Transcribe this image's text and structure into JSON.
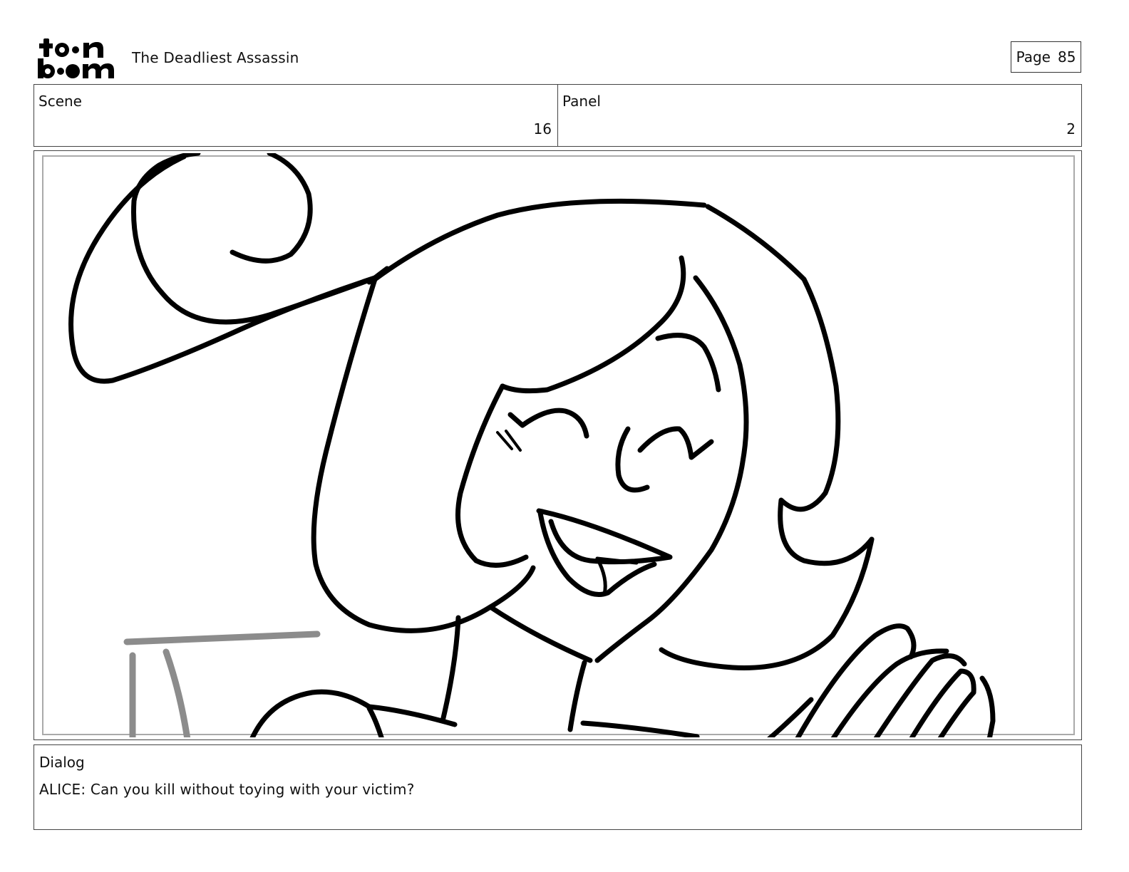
{
  "header": {
    "logo_text": "toon boom",
    "title": "The Deadliest Assassin",
    "page_label": "Page",
    "page_number": "85"
  },
  "scene": {
    "label": "Scene",
    "value": "16"
  },
  "panel": {
    "label": "Panel",
    "value": "2"
  },
  "dialog": {
    "label": "Dialog",
    "text": "ALICE: Can you kill without toying with your victim?"
  },
  "colors": {
    "ink": "#000000",
    "guide_gray": "#8c8c8c",
    "safe_frame": "#aaaaaa",
    "border": "#444444"
  }
}
